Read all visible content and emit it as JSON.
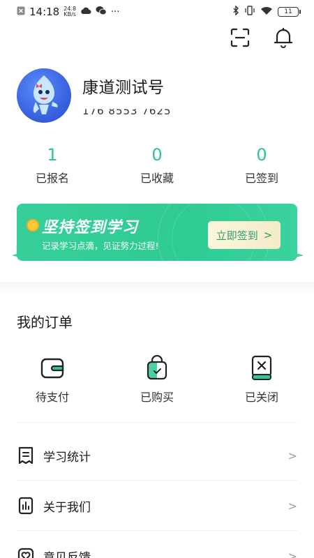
{
  "status_bar": {
    "time": "14:18",
    "net_speed_value": "24.8",
    "net_speed_unit": "KB/s",
    "more": "···",
    "battery": "11"
  },
  "profile": {
    "nickname": "康道测试号",
    "phone": "176 8553 7625"
  },
  "stats": [
    {
      "count": "1",
      "label": "已报名"
    },
    {
      "count": "0",
      "label": "已收藏"
    },
    {
      "count": "0",
      "label": "已签到"
    }
  ],
  "banner": {
    "title": "坚持签到学习",
    "subtitle": "记录学习点滴，见证努力过程!",
    "button_label": "立即签到",
    "button_chevron": ">"
  },
  "orders": {
    "title": "我的订单",
    "items": [
      {
        "label": "待支付",
        "icon": "wallet-icon"
      },
      {
        "label": "已购买",
        "icon": "bag-icon"
      },
      {
        "label": "已关闭",
        "icon": "closed-book-icon"
      }
    ]
  },
  "menu": [
    {
      "label": "学习统计",
      "icon": "receipt-icon",
      "chevron": ">"
    },
    {
      "label": "关于我们",
      "icon": "chart-doc-icon",
      "chevron": ">"
    },
    {
      "label": "意见反馈",
      "icon": "heart-icon",
      "chevron": ">"
    }
  ],
  "colors": {
    "accent": "#2fc690",
    "banner": "#33cd96",
    "button_bg": "#f6f0d0",
    "text": "#1a1a1a"
  }
}
